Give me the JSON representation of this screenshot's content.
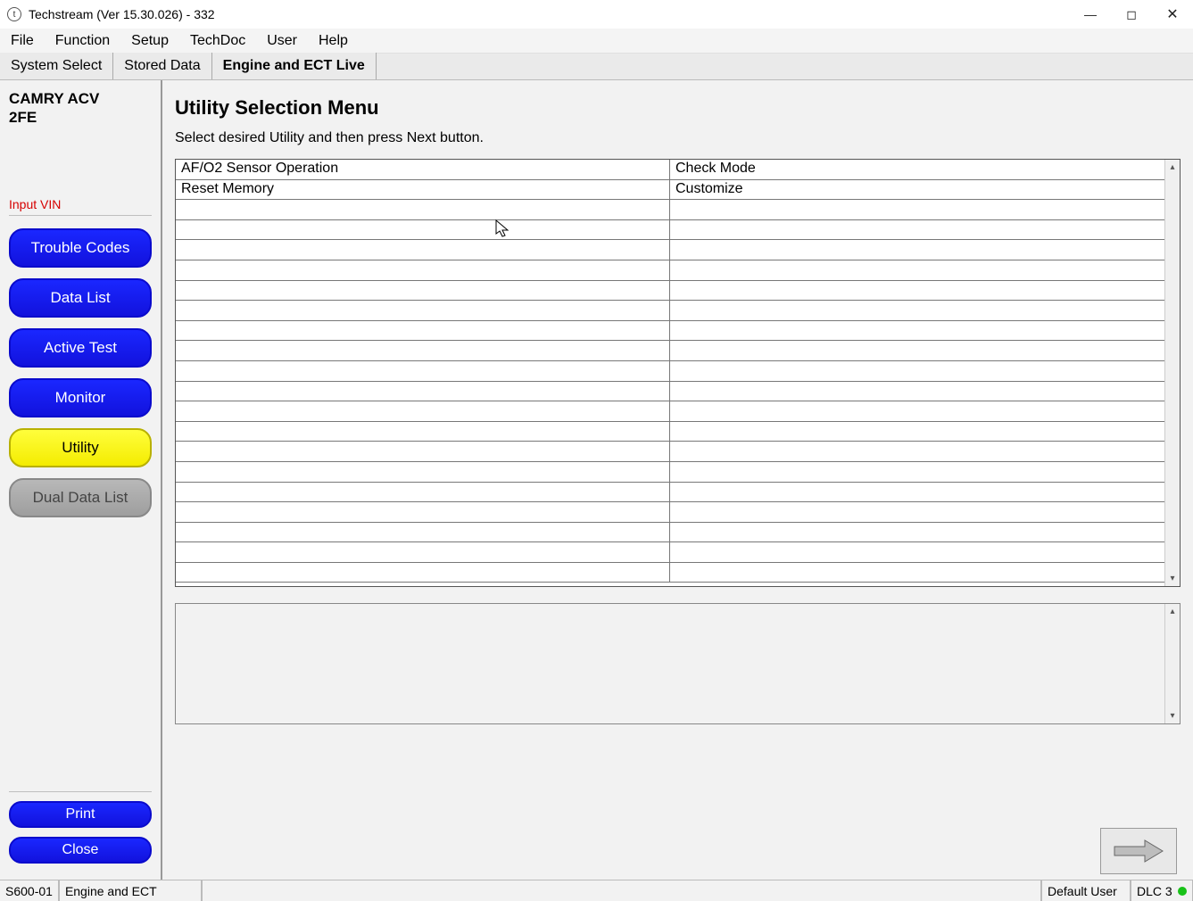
{
  "window": {
    "title": "Techstream (Ver 15.30.026) - 332"
  },
  "menu": {
    "items": [
      "File",
      "Function",
      "Setup",
      "TechDoc",
      "User",
      "Help"
    ]
  },
  "tabs": [
    {
      "label": "System Select",
      "active": false
    },
    {
      "label": "Stored Data",
      "active": false
    },
    {
      "label": "Engine and ECT Live",
      "active": true
    }
  ],
  "sidebar": {
    "vehicle_line1": "CAMRY ACV",
    "vehicle_line2": "2FE",
    "input_vin_label": "Input VIN",
    "buttons": [
      {
        "label": "Trouble Codes",
        "style": "blue"
      },
      {
        "label": "Data List",
        "style": "blue"
      },
      {
        "label": "Active Test",
        "style": "blue"
      },
      {
        "label": "Monitor",
        "style": "blue"
      },
      {
        "label": "Utility",
        "style": "yellow"
      },
      {
        "label": "Dual Data List",
        "style": "grey"
      }
    ],
    "print_label": "Print",
    "close_label": "Close"
  },
  "main": {
    "heading": "Utility Selection Menu",
    "subtitle": "Select desired Utility and then press Next button.",
    "utilities": [
      {
        "col1": "AF/O2 Sensor Operation",
        "col2": "Check Mode"
      },
      {
        "col1": "Reset Memory",
        "col2": "Customize"
      },
      {
        "col1": "",
        "col2": ""
      },
      {
        "col1": "",
        "col2": ""
      },
      {
        "col1": "",
        "col2": ""
      },
      {
        "col1": "",
        "col2": ""
      },
      {
        "col1": "",
        "col2": ""
      },
      {
        "col1": "",
        "col2": ""
      },
      {
        "col1": "",
        "col2": ""
      },
      {
        "col1": "",
        "col2": ""
      },
      {
        "col1": "",
        "col2": ""
      },
      {
        "col1": "",
        "col2": ""
      },
      {
        "col1": "",
        "col2": ""
      },
      {
        "col1": "",
        "col2": ""
      },
      {
        "col1": "",
        "col2": ""
      },
      {
        "col1": "",
        "col2": ""
      },
      {
        "col1": "",
        "col2": ""
      },
      {
        "col1": "",
        "col2": ""
      },
      {
        "col1": "",
        "col2": ""
      },
      {
        "col1": "",
        "col2": ""
      },
      {
        "col1": "",
        "col2": ""
      }
    ]
  },
  "statusbar": {
    "code": "S600-01",
    "system": "Engine and ECT",
    "user": "Default User",
    "conn": "DLC 3"
  }
}
